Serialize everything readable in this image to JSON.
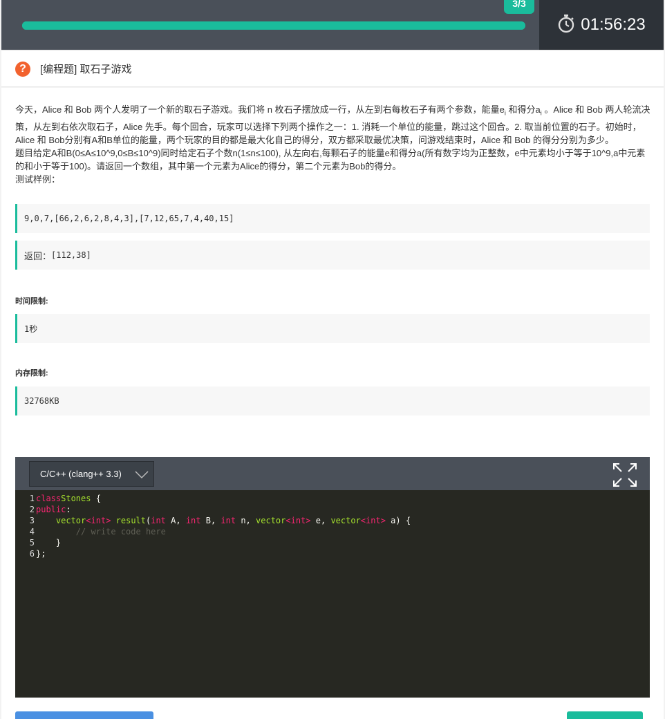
{
  "progress": {
    "badge": "3/3",
    "fraction": 1.0
  },
  "timer": {
    "value": "01:56:23",
    "icon": "stopwatch-icon"
  },
  "question": {
    "icon": "question-icon",
    "title": "[编程题] 取石子游戏",
    "desc_p1": "今天，Alice 和 Bob 两个人发明了一个新的取石子游戏。我们将 n 枚石子摆放成一行，从左到右每枚石子有两个参数，能量",
    "desc_e": "e",
    "desc_i1": "i",
    "desc_p2": " 和得分",
    "desc_a": "a",
    "desc_i2": "i",
    "desc_p3": " 。Alice 和 Bob 两人轮流决策，从左到右依次取石子，Alice 先手。每个回合，玩家可以选择下列两个操作之一：1. 消耗一个单位的能量，跳过这个回合。2. 取当前位置的石子。初始时，Alice 和 Bob分别有A和B单位的能量，两个玩家的目的都是最大化自己的得分，双方都采取最优决策，问游戏结束时，Alice 和 Bob 的得分分别为多少。",
    "desc_line2": "题目给定A和B(0≤A≤10^9,0≤B≤10^9)同时给定石子个数n(1≤n≤100), 从左向右,每颗石子的能量e和得分a(所有数字均为正整数，e中元素均小于等于10^9,a中元素的和小于等于100)。请返回一个数组，其中第一个元素为Alice的得分，第二个元素为Bob的得分。",
    "sample_label": "测试样例：",
    "sample_input": "9,0,7,[66,2,6,2,8,4,3],[7,12,65,7,4,40,15]",
    "sample_output_label": "返回：",
    "sample_output": "[112,38]",
    "time_limit_title": "时间限制:",
    "time_limit": "1秒",
    "memory_limit_title": "内存限制:",
    "memory_limit": "32768KB"
  },
  "editor": {
    "language": "C/C++ (clang++ 3.3)",
    "fullscreen_icon": "expand-icon",
    "line_numbers": [
      "1",
      "2",
      "3",
      "4",
      "5",
      "6"
    ],
    "code": {
      "l1_kw": "class",
      "l1_name": "Stones",
      "l1_rest": " {",
      "l2_kw": "public",
      "l2_rest": ":",
      "l3_indent": "    ",
      "l3_t1": "vector",
      "l3_lt1": "<",
      "l3_int1": "int",
      "l3_gt1": ">",
      "l3_fn": " result",
      "l3_p": "(",
      "l3_int2": "int",
      "l3_a": " A, ",
      "l3_int3": "int",
      "l3_b": " B, ",
      "l3_int4": "int",
      "l3_n": " n, ",
      "l3_t2": "vector",
      "l3_lt2": "<",
      "l3_int5": "int",
      "l3_gt2": ">",
      "l3_e": " e, ",
      "l3_t3": "vector",
      "l3_lt3": "<",
      "l3_int6": "int",
      "l3_gt3": ">",
      "l3_end": " a) {",
      "l4_indent": "        ",
      "l4_comment": "// write code here",
      "l5": "    }",
      "l6": "};"
    }
  },
  "colors": {
    "accent": "#1abc9c",
    "topbar": "#4a5059",
    "timer_bg": "#2d3238",
    "question_icon": "#f2622e",
    "editor_bg": "#272822",
    "keyword": "#f92672",
    "type": "#a6e22e"
  }
}
